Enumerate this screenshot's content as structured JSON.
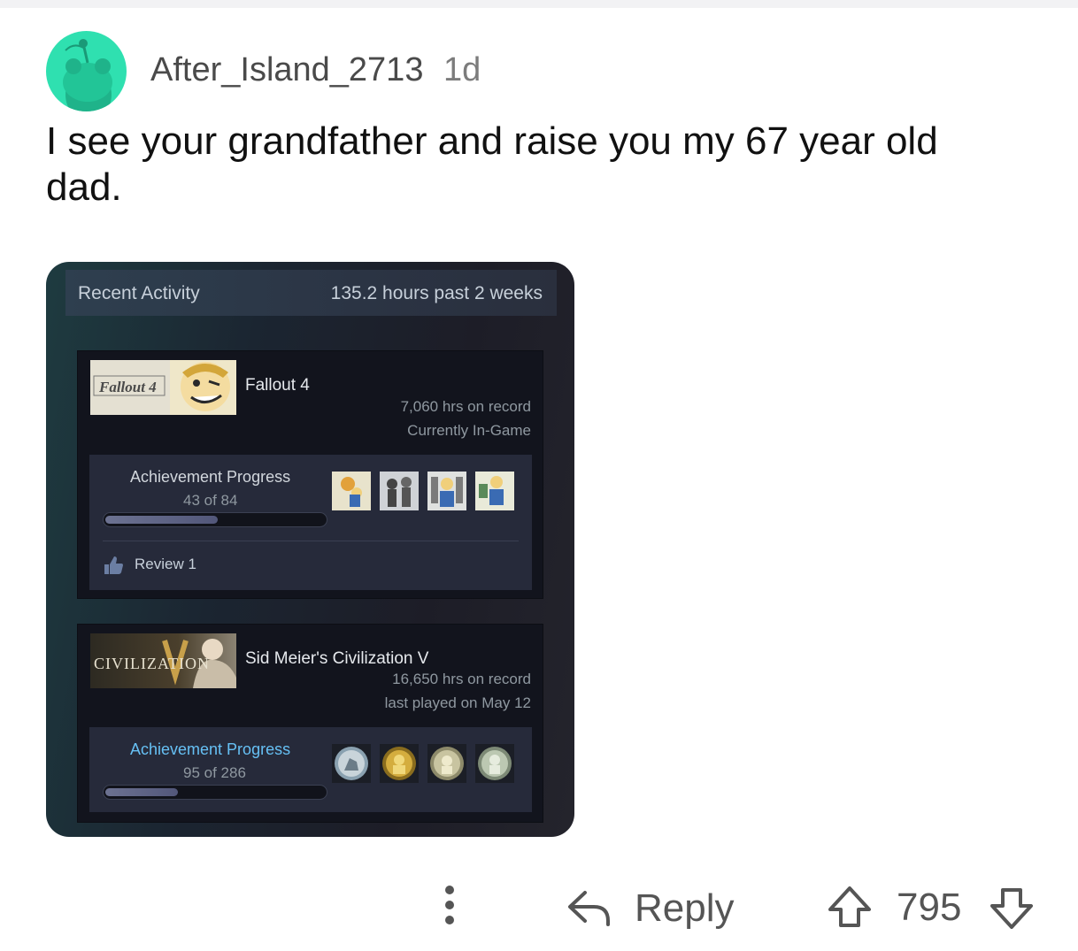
{
  "comment": {
    "username": "After_Island_2713",
    "age": "1d",
    "body": "I see your grandfather and raise you my 67 year old dad."
  },
  "steam": {
    "header": {
      "title": "Recent Activity",
      "hours": "135.2 hours past 2 weeks"
    },
    "games": [
      {
        "name": "Fallout 4",
        "capsule_text": "Fallout 4",
        "hours": "7,060 hrs on record",
        "status": "Currently In-Game",
        "achievement_label": "Achievement Progress",
        "achievement_count": "43 of 84",
        "progress_fraction": 0.512,
        "review": "Review 1"
      },
      {
        "name": "Sid Meier's Civilization V",
        "capsule_text": "CIVILIZATION",
        "hours": "16,650 hrs on record",
        "status": "last played on May 12",
        "achievement_label": "Achievement Progress",
        "achievement_count": "95 of 286",
        "progress_fraction": 0.332
      }
    ]
  },
  "actions": {
    "more_icon": "more-vertical-icon",
    "reply_label": "Reply",
    "score": "795"
  },
  "colors": {
    "avatar": "#2fe0b0",
    "steam_blue": "#66c0f4",
    "muted_text": "#555555"
  }
}
